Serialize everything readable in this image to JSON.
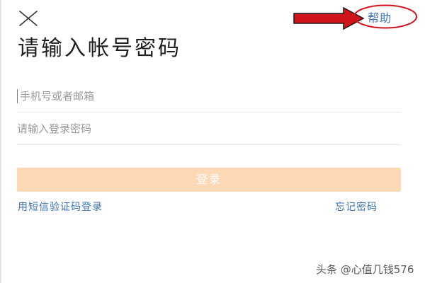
{
  "header": {
    "close_icon": "close-icon",
    "help_label": "帮助"
  },
  "title": "请输入帐号密码",
  "form": {
    "account_placeholder": "手机号或者邮箱",
    "password_placeholder": "请输入登录密码",
    "login_label": "登录",
    "login_button_color": "#fdd9b6"
  },
  "links": {
    "sms_login": "用短信验证码登录",
    "forgot_password": "忘记密码"
  },
  "annotation": {
    "arrow_color": "#d0141b",
    "circle_color": "#d0141b"
  },
  "watermark": "头条 @心值几钱576",
  "colors": {
    "link": "#3f72b4",
    "title": "#1f1f1f",
    "placeholder": "#9a9a9a"
  }
}
